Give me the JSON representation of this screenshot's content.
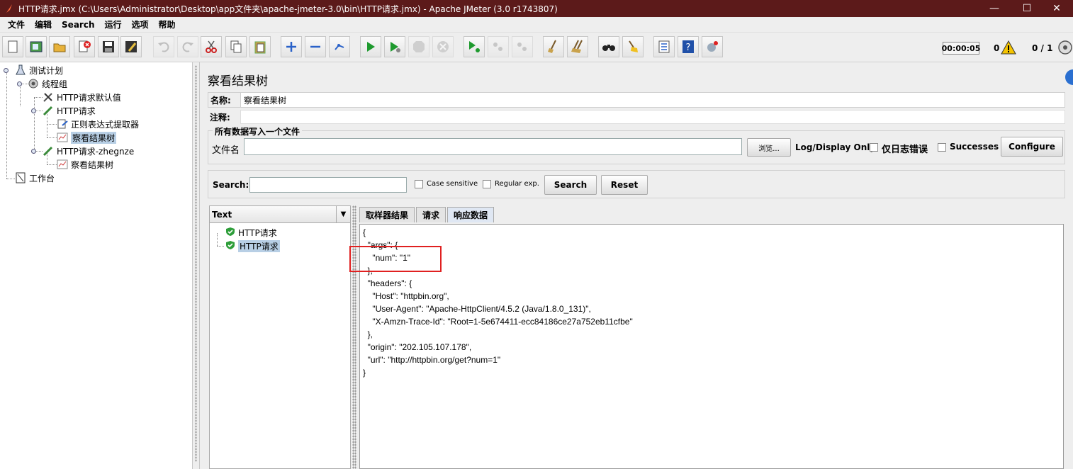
{
  "window": {
    "title": "HTTP请求.jmx (C:\\Users\\Administrator\\Desktop\\app文件夹\\apache-jmeter-3.0\\bin\\HTTP请求.jmx) - Apache JMeter (3.0 r1743807)",
    "minimize": "—",
    "maximize": "☐",
    "close": "✕"
  },
  "menu": [
    "文件",
    "编辑",
    "Search",
    "运行",
    "选项",
    "帮助"
  ],
  "toolbar": {
    "icons": [
      "new-icon",
      "templates-icon",
      "open-icon",
      "close-icon",
      "save-icon",
      "save-as-icon",
      "undo-icon",
      "redo-icon",
      "cut-icon",
      "copy-icon",
      "paste-icon",
      "expand-icon",
      "collapse-icon",
      "toggle-icon",
      "start-icon",
      "start-no-pause-icon",
      "stop-icon",
      "shutdown-icon",
      "remote-start-icon",
      "remote-stop-icon",
      "remote-shutdown-icon",
      "clear-icon",
      "clear-all-icon",
      "search-icon",
      "reset-search-icon",
      "function-helper-icon",
      "help-icon",
      "logger-icon"
    ],
    "timer": "00:00:05",
    "error_count": "0",
    "threads": "0 / 1"
  },
  "tree": [
    {
      "label": "测试计划",
      "icon": "test-plan-icon"
    },
    {
      "label": "线程组",
      "icon": "thread-group-icon"
    },
    {
      "label": "HTTP请求默认值",
      "icon": "config-tool-icon"
    },
    {
      "label": "HTTP请求",
      "icon": "sampler-icon"
    },
    {
      "label": "正则表达式提取器",
      "icon": "post-processor-icon"
    },
    {
      "label": "察看结果树",
      "icon": "listener-icon",
      "selected": true
    },
    {
      "label": "HTTP请求-zhegnze",
      "icon": "sampler-icon"
    },
    {
      "label": "察看结果树",
      "icon": "listener-icon"
    },
    {
      "label": "工作台",
      "icon": "workbench-icon"
    }
  ],
  "panel": {
    "title": "察看结果树",
    "name_label": "名称:",
    "name_value": "察看结果树",
    "comment_label": "注释:",
    "comment_value": "",
    "file_group_title": "所有数据写入一个文件",
    "filename_label": "文件名",
    "filename_value": "",
    "browse_label": "浏览...",
    "log_display_label": "Log/Display Only:",
    "errors_only_label": "仅日志错误",
    "successes_label": "Successes",
    "configure_label": "Configure"
  },
  "search": {
    "label": "Search:",
    "value": "",
    "case_sensitive_label": "Case sensitive",
    "regex_label": "Regular exp.",
    "search_button": "Search",
    "reset_button": "Reset"
  },
  "results": {
    "renderer": "Text",
    "items": [
      {
        "label": "HTTP请求",
        "status": "success"
      },
      {
        "label": "HTTP请求",
        "status": "success",
        "selected": true
      }
    ],
    "tabs": [
      "取样器结果",
      "请求",
      "响应数据"
    ],
    "active_tab": "响应数据",
    "response_lines": [
      "{",
      "  \"args\": {",
      "    \"num\": \"1\"",
      "  },",
      "  \"headers\": {",
      "    \"Host\": \"httpbin.org\",",
      "    \"User-Agent\": \"Apache-HttpClient/4.5.2 (Java/1.8.0_131)\",",
      "    \"X-Amzn-Trace-Id\": \"Root=1-5e674411-ecc84186ce27a752eb11cfbe\"",
      "  },",
      "  \"origin\": \"202.105.107.178\",",
      "  \"url\": \"http://httpbin.org/get?num=1\"",
      "}"
    ]
  },
  "colors": {
    "titlebar": "#5c1a1a",
    "selection": "#b8cfe5",
    "highlight": "#e02020",
    "success": "#2e9e3a"
  }
}
